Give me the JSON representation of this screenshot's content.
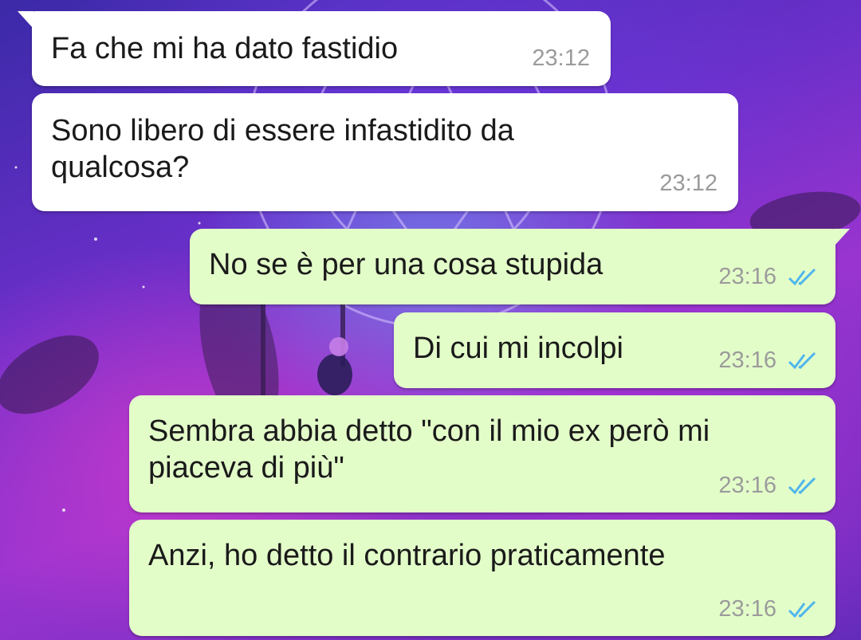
{
  "chat": {
    "messages": [
      {
        "direction": "incoming",
        "text": "Fa che mi ha dato fastidio",
        "time": "23:12"
      },
      {
        "direction": "incoming",
        "text": "Sono libero di essere infastidito da qualcosa?",
        "time": "23:12"
      },
      {
        "direction": "outgoing",
        "text": "No se è per una cosa stupida",
        "time": "23:16",
        "status": "read"
      },
      {
        "direction": "outgoing",
        "text": "Di cui mi incolpi",
        "time": "23:16",
        "status": "read"
      },
      {
        "direction": "outgoing",
        "text": "Sembra abbia detto \"con il mio ex però mi piaceva di più\"",
        "time": "23:16",
        "status": "read"
      },
      {
        "direction": "outgoing",
        "text": "Anzi, ho detto il contrario praticamente",
        "time": "23:16",
        "status": "read"
      }
    ]
  },
  "icons": {
    "read_receipt": "double-check-icon"
  },
  "colors": {
    "incoming_bubble": "#ffffff",
    "outgoing_bubble": "#e3fdc9",
    "read_ticks": "#4fb6ec",
    "timestamp": "#9b9b9b"
  }
}
